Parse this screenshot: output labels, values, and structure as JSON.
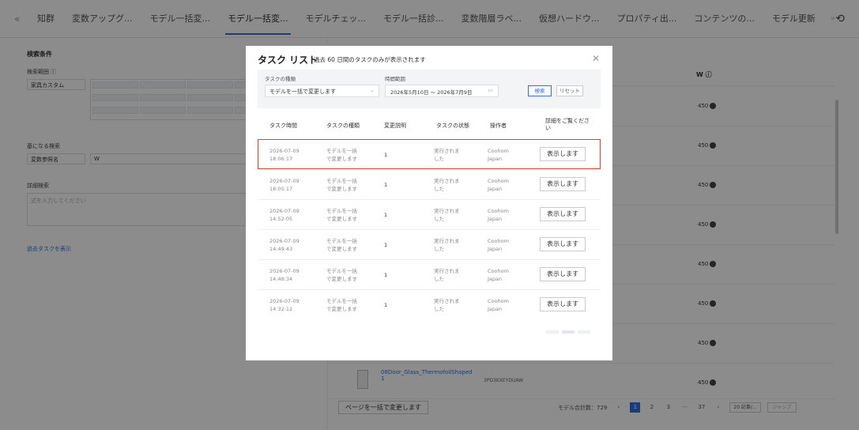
{
  "topbar": {
    "tabs": [
      {
        "label": "知群",
        "active": false
      },
      {
        "label": "変数アップグ...",
        "active": false
      },
      {
        "label": "モデル一括変...",
        "active": false
      },
      {
        "label": "モデル一括変...",
        "active": true
      },
      {
        "label": "モデルチェッ...",
        "active": false
      },
      {
        "label": "モデル一括診...",
        "active": false
      },
      {
        "label": "変数階層ラベ...",
        "active": false
      },
      {
        "label": "仮想ハードウ...",
        "active": false
      },
      {
        "label": "プロパティ出...",
        "active": false
      },
      {
        "label": "コンテンツの...",
        "active": false
      },
      {
        "label": "モデル更新",
        "active": false
      }
    ]
  },
  "left_panel": {
    "heading": "検索条件",
    "range_label": "検索範囲 ⓘ",
    "range_select": "家具カスタム",
    "base_search_label": "基になる検索",
    "variable_select": "変数参照名",
    "variable_value": "W",
    "detail_label": "詳細検索",
    "detail_placeholder": "式を入力してください",
    "history_link": "過去タスクを表示"
  },
  "right_panel": {
    "column_header": "W ⓘ",
    "prices": [
      "450",
      "450",
      "450",
      "450",
      "450",
      "450",
      "450",
      "450"
    ],
    "product_name": "08Door_Glass_ThermofoilShaped 1",
    "product_code": "3PD3KXEYDUAW",
    "bulk_button": "ページを一括で変更します",
    "pagination": {
      "total": "モデル合計数：729",
      "pages": [
        "1",
        "2",
        "3",
        "···",
        "37"
      ],
      "page_size": "20 記事/...",
      "jump": "ジャンプ"
    }
  },
  "modal": {
    "title": "タスク リスト",
    "subtitle": "過去 60 日間のタスクのみが表示されます",
    "filters": {
      "type_label": "タスクの種類",
      "type_value": "モデルを一括で変更します",
      "range_label": "時間範囲",
      "range_value": "2026年5月10日 ～ 2026年7月9日",
      "search_button": "検索",
      "reset_button": "リセット"
    },
    "columns": [
      "タスク時間",
      "タスクの種類",
      "変更説明",
      "タスクの状態",
      "操作者",
      "詳細をご覧ください"
    ],
    "rows": [
      {
        "date": "2026-07-09",
        "time": "18:06:17",
        "type_1": "モデルを一括",
        "type_2": "で変更します",
        "desc": "1",
        "status_1": "実行されま",
        "status_2": "した",
        "op_1": "Coohom",
        "op_2": "Japan",
        "action": "表示します",
        "highlight": true
      },
      {
        "date": "2026-07-09",
        "time": "18:05:17",
        "type_1": "モデルを一括",
        "type_2": "で変更します",
        "desc": "1",
        "status_1": "実行されま",
        "status_2": "した",
        "op_1": "Coohom",
        "op_2": "Japan",
        "action": "表示します",
        "highlight": false
      },
      {
        "date": "2026-07-09",
        "time": "14:52:05",
        "type_1": "モデルを一括",
        "type_2": "で変更します",
        "desc": "1",
        "status_1": "実行されま",
        "status_2": "した",
        "op_1": "Coohom",
        "op_2": "Japan",
        "action": "表示します",
        "highlight": false
      },
      {
        "date": "2026-07-09",
        "time": "14:49:43",
        "type_1": "モデルを一括",
        "type_2": "で変更します",
        "desc": "1",
        "status_1": "実行されま",
        "status_2": "した",
        "op_1": "Coohom",
        "op_2": "Japan",
        "action": "表示します",
        "highlight": false
      },
      {
        "date": "2026-07-09",
        "time": "14:48:34",
        "type_1": "モデルを一括",
        "type_2": "で変更します",
        "desc": "1",
        "status_1": "実行されま",
        "status_2": "した",
        "op_1": "Coohom",
        "op_2": "Japan",
        "action": "表示します",
        "highlight": false
      },
      {
        "date": "2026-07-09",
        "time": "14:32:12",
        "type_1": "モデルを一括",
        "type_2": "で変更します",
        "desc": "1",
        "status_1": "実行されま",
        "status_2": "した",
        "op_1": "Coohom",
        "op_2": "Japan",
        "action": "表示します",
        "highlight": false
      }
    ]
  },
  "colors": {
    "accent": "#2f6fe0",
    "highlight": "#d9412f"
  }
}
